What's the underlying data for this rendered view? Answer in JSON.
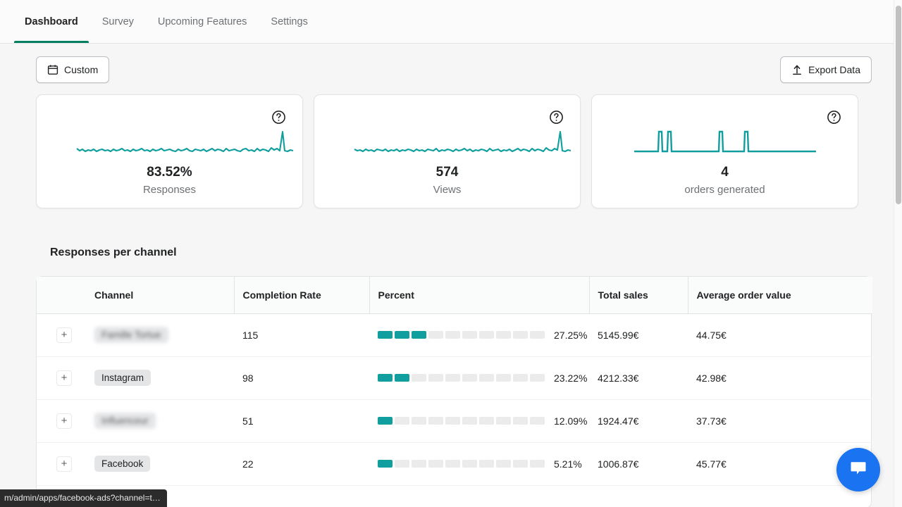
{
  "tabs": [
    {
      "label": "Dashboard",
      "active": true
    },
    {
      "label": "Survey",
      "active": false
    },
    {
      "label": "Upcoming Features",
      "active": false
    },
    {
      "label": "Settings",
      "active": false
    }
  ],
  "toolbar": {
    "date_range_label": "Custom",
    "date_range_icon": "calendar-icon",
    "export_label": "Export Data",
    "export_icon": "upload-icon"
  },
  "colors": {
    "accent_teal": "#119e9e",
    "active_tab_green": "#008060",
    "chat_blue": "#1a73f0",
    "segment_empty": "#ebebeb"
  },
  "cards": [
    {
      "value": "83.52%",
      "label": "Responses",
      "help_icon": "question-mark-circle-icon",
      "sparkline_type": "noisy-line-with-spike"
    },
    {
      "value": "574",
      "label": "Views",
      "help_icon": "question-mark-circle-icon",
      "sparkline_type": "noisy-line-with-spike"
    },
    {
      "value": "4",
      "label": "orders generated",
      "help_icon": "question-mark-circle-icon",
      "sparkline_type": "flat-line-with-four-spikes"
    }
  ],
  "section": {
    "title": "Responses per channel"
  },
  "table": {
    "columns": [
      "",
      "Channel",
      "Completion Rate",
      "Percent",
      "Total sales",
      "Average order value"
    ],
    "rows": [
      {
        "expand": "+",
        "channel": "Famille Tortue",
        "channel_blurred": true,
        "completion_rate": "115",
        "percent": "27.25%",
        "segments_filled": 3,
        "segments_total": 10,
        "total_sales": "5145.99€",
        "average_order_value": "44.75€"
      },
      {
        "expand": "+",
        "channel": "Instagram",
        "channel_blurred": false,
        "completion_rate": "98",
        "percent": "23.22%",
        "segments_filled": 2,
        "segments_total": 10,
        "total_sales": "4212.33€",
        "average_order_value": "42.98€"
      },
      {
        "expand": "+",
        "channel": "Influenceur",
        "channel_blurred": true,
        "completion_rate": "51",
        "percent": "12.09%",
        "segments_filled": 1,
        "segments_total": 10,
        "total_sales": "1924.47€",
        "average_order_value": "37.73€"
      },
      {
        "expand": "+",
        "channel": "Facebook",
        "channel_blurred": false,
        "completion_rate": "22",
        "percent": "5.21%",
        "segments_filled": 1,
        "segments_total": 10,
        "total_sales": "1006.87€",
        "average_order_value": "45.77€"
      }
    ]
  },
  "chat_widget": {
    "icon": "chat-bubble-icon"
  },
  "status_bar": {
    "url": "m/admin/apps/facebook-ads?channel=t…"
  },
  "chart_data": [
    {
      "type": "line",
      "title": "Responses",
      "value": 83.52,
      "unit": "%",
      "series": [
        {
          "name": "Responses",
          "values": [
            50,
            47,
            49,
            48,
            50,
            49,
            47,
            50,
            48,
            49,
            50,
            48,
            47,
            49,
            50,
            48,
            50,
            49,
            47,
            50,
            48,
            49,
            50,
            47,
            49,
            48,
            50,
            49,
            48,
            50,
            47,
            49,
            50,
            48,
            49,
            47,
            50,
            48,
            49,
            50,
            48,
            47,
            49,
            50,
            48,
            49,
            50,
            47,
            49,
            48,
            50,
            49,
            47,
            50,
            48,
            49,
            50,
            48,
            47,
            49,
            50,
            48,
            49,
            47,
            50,
            48,
            49,
            50,
            47,
            48,
            50,
            49,
            47,
            50,
            48,
            49,
            50,
            47,
            100,
            46,
            48,
            49
          ]
        }
      ],
      "ylim": [
        40,
        100
      ],
      "grid": false,
      "legend": "none"
    },
    {
      "type": "line",
      "title": "Views",
      "value": 574,
      "series": [
        {
          "name": "Views",
          "values": [
            50,
            48,
            50,
            49,
            47,
            50,
            48,
            49,
            50,
            47,
            49,
            48,
            50,
            49,
            47,
            50,
            48,
            49,
            47,
            50,
            49,
            48,
            50,
            47,
            49,
            50,
            48,
            47,
            49,
            50,
            48,
            49,
            47,
            50,
            48,
            50,
            49,
            47,
            48,
            50,
            49,
            47,
            50,
            48,
            49,
            50,
            47,
            48,
            50,
            49,
            47,
            50,
            48,
            49,
            50,
            48,
            47,
            49,
            50,
            48,
            49,
            47,
            50,
            49,
            48,
            50,
            47,
            49,
            48,
            50,
            49,
            47,
            50,
            48,
            49,
            47,
            50,
            48,
            100,
            46,
            49,
            48
          ]
        }
      ],
      "ylim": [
        40,
        100
      ],
      "grid": false,
      "legend": "none"
    },
    {
      "type": "line",
      "title": "orders generated",
      "value": 4,
      "series": [
        {
          "name": "orders",
          "values": [
            0,
            0,
            0,
            0,
            0,
            0,
            0,
            0,
            0,
            0,
            0,
            0,
            0,
            0,
            1,
            0,
            0,
            1,
            0,
            0,
            0,
            0,
            0,
            0,
            0,
            0,
            0,
            0,
            0,
            0,
            0,
            0,
            0,
            0,
            0,
            0,
            0,
            0,
            0,
            0,
            0,
            0,
            0,
            0,
            0,
            0,
            1,
            0,
            0,
            0,
            0,
            0,
            0,
            0,
            1,
            0,
            0,
            0,
            0,
            0,
            0,
            0,
            0,
            0,
            0,
            0,
            0,
            0,
            0,
            0,
            0,
            0,
            0,
            0,
            0,
            0,
            0,
            0,
            0,
            0
          ]
        }
      ],
      "ylim": [
        0,
        1
      ],
      "grid": false,
      "legend": "none"
    },
    {
      "type": "bar",
      "title": "Responses per channel",
      "categories": [
        "Famille Tortue",
        "Instagram",
        "Influenceur",
        "Facebook"
      ],
      "values": [
        27.25,
        23.22,
        12.09,
        5.21
      ],
      "xlabel": "Channel",
      "ylabel": "Percent",
      "ylim": [
        0,
        100
      ],
      "grid": false,
      "legend": "none"
    }
  ]
}
